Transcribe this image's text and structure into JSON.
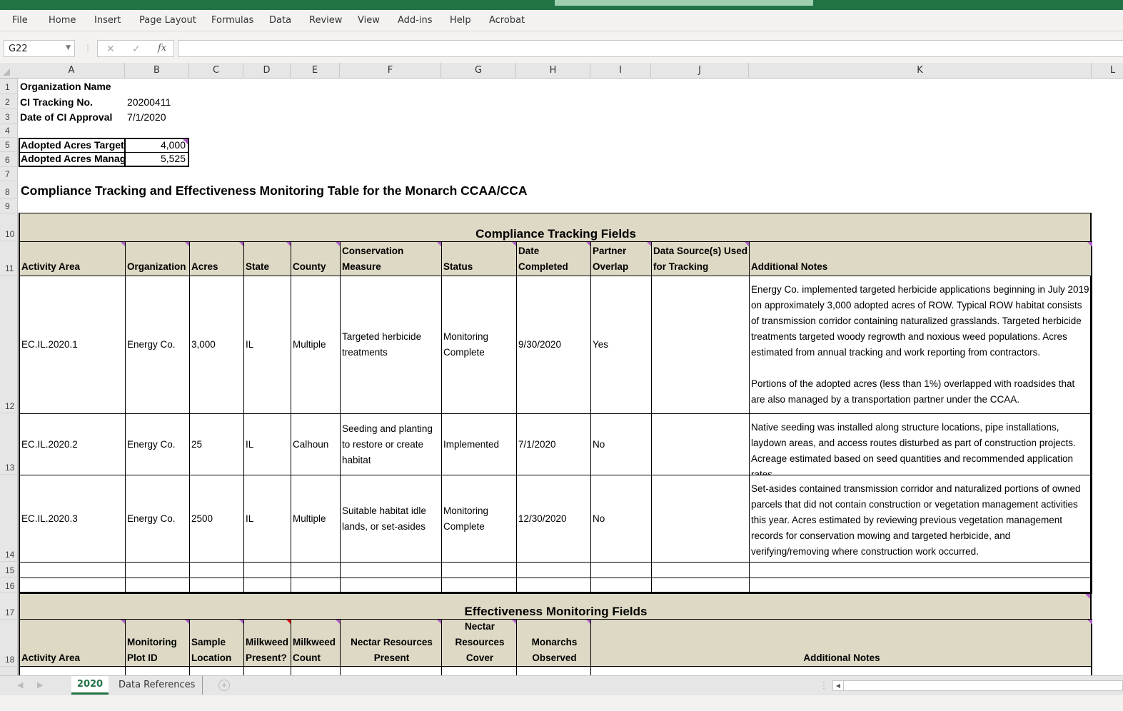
{
  "ribbon": {
    "menu": [
      "File",
      "Home",
      "Insert",
      "Page Layout",
      "Formulas",
      "Data",
      "Review",
      "View",
      "Add-ins",
      "Help",
      "Acrobat"
    ]
  },
  "formula_bar": {
    "name_box": "G22",
    "cancel_icon": "✕",
    "enter_icon": "✓",
    "fx_label": "fx",
    "value": ""
  },
  "columns": [
    "A",
    "B",
    "C",
    "D",
    "E",
    "F",
    "G",
    "H",
    "I",
    "J",
    "K",
    "L"
  ],
  "rows": [
    "1",
    "2",
    "3",
    "4",
    "5",
    "6",
    "7",
    "8",
    "9",
    "10",
    "11",
    "12",
    "13",
    "14",
    "15",
    "16",
    "17",
    "18"
  ],
  "info": {
    "org_label": "Organization Name",
    "tracking_label": "CI Tracking No.",
    "tracking_value": "20200411",
    "approval_label": "Date of CI Approval",
    "approval_value": "7/1/2020",
    "target_label": "Adopted Acres Target",
    "target_value": "4,000",
    "managed_label": "Adopted Acres Managed",
    "managed_value": "5,525"
  },
  "sheet_title": "Compliance Tracking and Effectiveness Monitoring Table for the Monarch CCAA/CCA",
  "compliance": {
    "section_title": "Compliance Tracking Fields",
    "headers": [
      "Activity Area",
      "Organization",
      "Acres",
      "State",
      "County",
      "Conservation Measure",
      "Status",
      "Date Completed",
      "Partner\nOverlap",
      "Data Source(s) Used\nfor Tracking",
      "Additional Notes"
    ],
    "rows": [
      {
        "activity": "EC.IL.2020.1",
        "org": "Energy Co.",
        "acres": "3,000",
        "state": "IL",
        "county": "Multiple",
        "measure": "Targeted herbicide treatments",
        "status": "Monitoring Complete",
        "date": "9/30/2020",
        "overlap": "Yes",
        "source": "",
        "notes": "Energy Co. implemented targeted herbicide applications beginning in July 2019 on approximately 3,000 adopted acres of ROW. Typical ROW habitat consists of transmission corridor containing naturalized grasslands. Targeted herbicide treatments targeted woody regrowth and noxious weed populations. Acres estimated from annual tracking and work reporting from contractors.\n\nPortions of the adopted acres (less than 1%) overlapped with roadsides that are also managed by a transportation partner under the CCAA."
      },
      {
        "activity": "EC.IL.2020.2",
        "org": "Energy Co.",
        "acres": "25",
        "state": "IL",
        "county": "Calhoun",
        "measure": "Seeding and planting to restore or create habitat",
        "status": "Implemented",
        "date": "7/1/2020",
        "overlap": "No",
        "source": "",
        "notes": "Native seeding was installed along structure locations, pipe installations, laydown areas, and access routes disturbed as part of construction projects. Acreage estimated based on seed quantities and recommended application rates."
      },
      {
        "activity": "EC.IL.2020.3",
        "org": "Energy Co.",
        "acres": "2500",
        "state": "IL",
        "county": "Multiple",
        "measure": "Suitable habitat idle lands, or set-asides",
        "status": "Monitoring Complete",
        "date": "12/30/2020",
        "overlap": "No",
        "source": "",
        "notes": "Set-asides contained transmission corridor and naturalized portions of owned parcels that did not contain construction or vegetation management activities this year. Acres estimated by reviewing previous vegetation management records for conservation mowing and targeted herbicide, and verifying/removing where construction work occurred."
      }
    ]
  },
  "effectiveness": {
    "section_title": "Effectiveness Monitoring Fields",
    "headers": [
      "Activity Area",
      "Monitoring\nPlot ID",
      "Sample\nLocation",
      "Milkweed\nPresent?",
      "Milkweed\nCount",
      "Nectar Resources\nPresent",
      "Nectar\nResources\nCover",
      "Monarchs\nObserved",
      "Additional Notes"
    ]
  },
  "sheet_tabs": {
    "active": "2020",
    "other": "Data References",
    "add_icon": "+"
  }
}
